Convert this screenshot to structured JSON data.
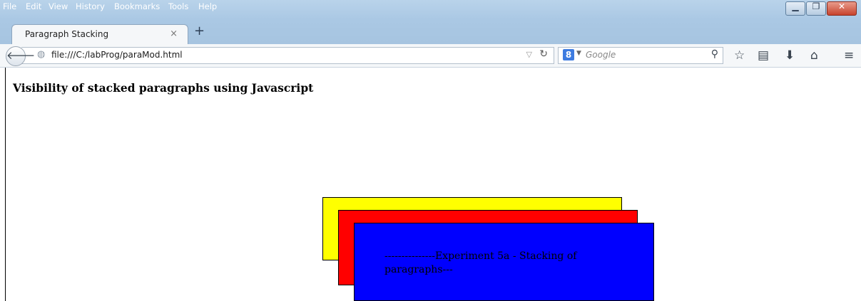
{
  "menubar": {
    "items": [
      "File",
      "Edit",
      "View",
      "History",
      "Bookmarks",
      "Tools",
      "Help"
    ],
    "window_controls": [
      "minimize",
      "restore",
      "close"
    ]
  },
  "tabs": [
    {
      "label": "Paragraph Stacking",
      "close_glyph": "×"
    }
  ],
  "new_tab_glyph": "+",
  "navbar": {
    "url": "file:///C:/labProg/paraMod.html",
    "search_engine": "Google",
    "search_placeholder": "Google"
  },
  "icons": {
    "back": "back-arrow-icon",
    "site": "globe-icon",
    "reload": "reload-icon",
    "search": "magnifier-icon",
    "bookmark": "star-icon",
    "reading_list": "clipboard-icon",
    "downloads": "download-arrow-icon",
    "home": "home-icon",
    "menu": "hamburger-menu-icon"
  },
  "page": {
    "heading": "Visibility of stacked paragraphs using Javascript",
    "paragraphs": [
      {
        "color": "#ffff00",
        "text": ""
      },
      {
        "color": "#ff0000",
        "text": ""
      },
      {
        "color": "#0000ff",
        "text": "---------------Experiment 5a - Stacking of paragraphs---"
      }
    ]
  }
}
